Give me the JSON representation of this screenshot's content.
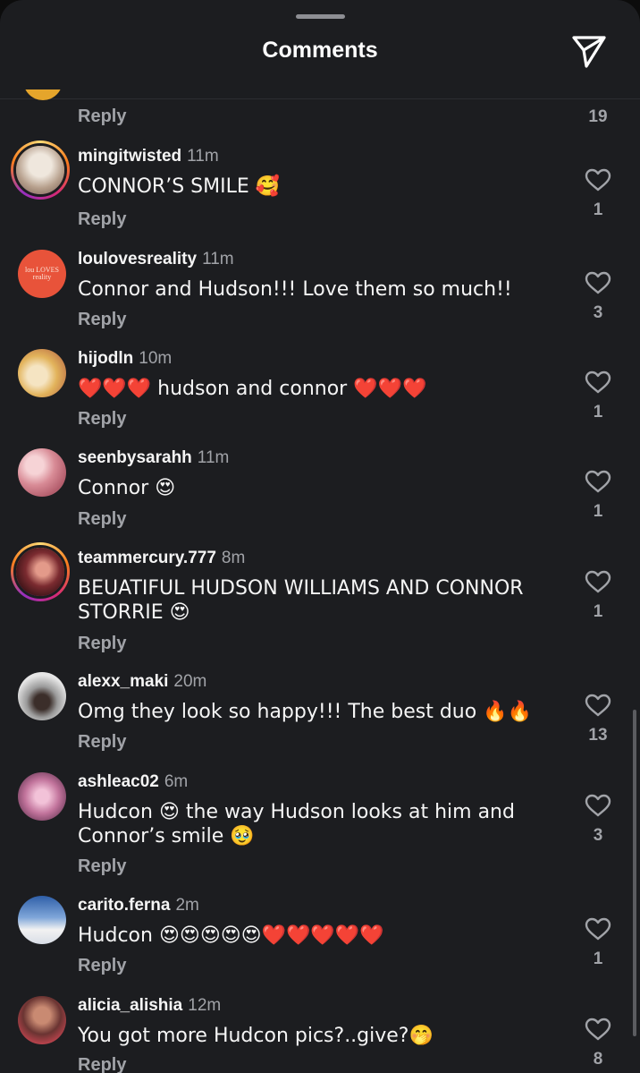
{
  "header": {
    "title": "Comments",
    "share_icon": "paper-plane-icon"
  },
  "top": {
    "reply_label": "Reply",
    "like_count": "19"
  },
  "reply_label": "Reply",
  "comments": [
    {
      "username": "mingitwisted",
      "time": "11m",
      "text": "CONNOR’S SMILE 🥰",
      "likes": "1",
      "ring": true,
      "avatar_color": "#c9b7a6"
    },
    {
      "username": "loulovesreality",
      "time": "11m",
      "text": "Connor and Hudson!!! Love them so much!!",
      "likes": "3",
      "ring": false,
      "avatar_color": "#e8533a",
      "avatar_text": "lou LOVES reality"
    },
    {
      "username": "hijodln",
      "time": "10m",
      "text": "❤️❤️❤️ hudson and connor ❤️❤️❤️",
      "likes": "1",
      "ring": false,
      "avatar_color": "#d9c28a"
    },
    {
      "username": "seenbysarahh",
      "time": "11m",
      "text": "Connor 😍",
      "likes": "1",
      "ring": false,
      "avatar_color": "#d79aa3"
    },
    {
      "username": "teammercury.777",
      "time": "8m",
      "text": "BEUATIFUL HUDSON WILLIAMS AND CONNOR STORRIE 😍",
      "likes": "1",
      "ring": true,
      "avatar_color": "#5a1e24"
    },
    {
      "username": "alexx_maki",
      "time": "20m",
      "text": "Omg they look so happy!!! The best duo 🔥🔥",
      "likes": "13",
      "ring": false,
      "avatar_color": "#d9d9d9"
    },
    {
      "username": "ashleac02",
      "time": "6m",
      "text": "Hudcon 😍 the way Hudson looks at him and Connor’s smile 🥹",
      "likes": "3",
      "ring": false,
      "avatar_color": "#c97ba6"
    },
    {
      "username": "carito.ferna",
      "time": "2m",
      "text": "Hudcon 😍😍😍😍😍❤️❤️❤️❤️❤️",
      "likes": "1",
      "ring": false,
      "avatar_color": "#5d86c4"
    },
    {
      "username": "alicia_alishia",
      "time": "12m",
      "text": "You got more Hudcon pics?..give?🤭",
      "likes": "8",
      "ring": false,
      "avatar_color": "#7a3a3c"
    }
  ]
}
